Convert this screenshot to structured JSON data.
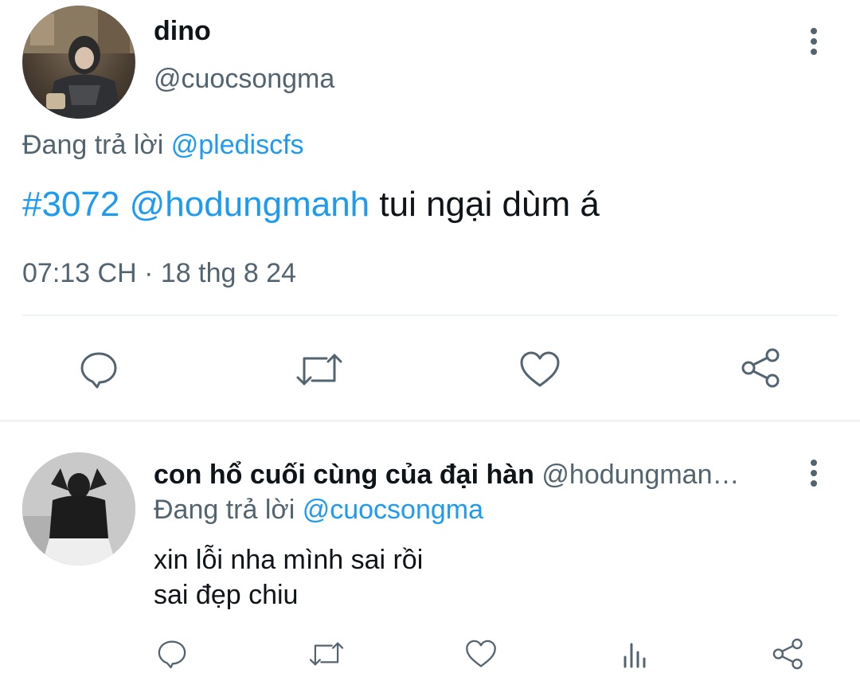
{
  "main_tweet": {
    "display_name": "dino",
    "handle": "@cuocsongma",
    "reply_prefix": "Đang trả lời",
    "reply_to": "@plediscfs",
    "hashtag": "#3072",
    "mention": "@hodungmanh",
    "body_text": "tui ngại dùm á",
    "timestamp": "07:13 CH · 18 thg 8 24",
    "actions": [
      "reply-icon",
      "retweet-icon",
      "like-icon",
      "share-icon"
    ]
  },
  "reply_tweet": {
    "display_name": "con hổ cuối cùng của đại hàn",
    "handle": "@hodungman…",
    "reply_prefix": "Đang trả lời",
    "reply_to": "@cuocsongma",
    "line1": "xin lỗi nha mình sai rồi",
    "line2": "sai đẹp chiu",
    "actions": [
      "reply-icon",
      "retweet-icon",
      "like-icon",
      "views-icon",
      "share-icon"
    ]
  },
  "colors": {
    "link": "#1d9bf0",
    "muted": "#536471",
    "text": "#0f1419",
    "divider": "#eff3f4"
  }
}
